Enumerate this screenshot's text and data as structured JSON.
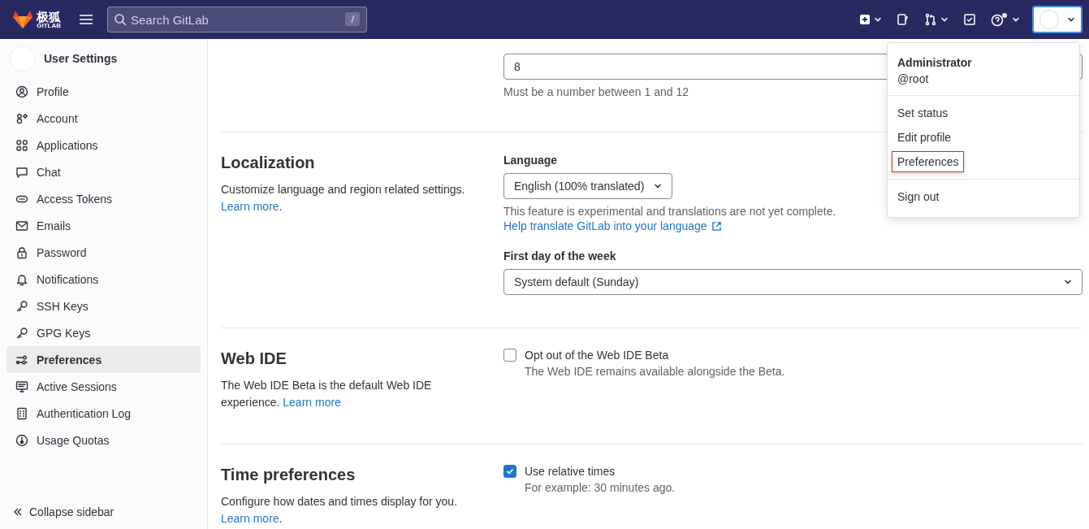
{
  "topbar": {
    "logo_text": "极狐",
    "logo_subtext": "GITLAB",
    "search": {
      "placeholder": "Search GitLab",
      "shortcut": "/"
    }
  },
  "sidebar": {
    "title": "User Settings",
    "items": [
      {
        "label": "Profile",
        "selected": false
      },
      {
        "label": "Account",
        "selected": false
      },
      {
        "label": "Applications",
        "selected": false
      },
      {
        "label": "Chat",
        "selected": false
      },
      {
        "label": "Access Tokens",
        "selected": false
      },
      {
        "label": "Emails",
        "selected": false
      },
      {
        "label": "Password",
        "selected": false
      },
      {
        "label": "Notifications",
        "selected": false
      },
      {
        "label": "SSH Keys",
        "selected": false
      },
      {
        "label": "GPG Keys",
        "selected": false
      },
      {
        "label": "Preferences",
        "selected": true
      },
      {
        "label": "Active Sessions",
        "selected": false
      },
      {
        "label": "Authentication Log",
        "selected": false
      },
      {
        "label": "Usage Quotas",
        "selected": false
      }
    ],
    "collapse": "Collapse sidebar"
  },
  "sections": [
    {
      "controls": [
        {
          "kind": "input",
          "value": "8"
        },
        {
          "kind": "help",
          "text": "Must be a number between 1 and 12"
        }
      ]
    },
    {
      "title": "Localization",
      "description": "Customize language and region related settings.",
      "link": "Learn more",
      "after": ".",
      "controls": [
        {
          "kind": "label",
          "text": "Language"
        },
        {
          "kind": "select",
          "value": "English (100% translated)",
          "compact": true
        },
        {
          "kind": "help",
          "text": "This feature is experimental and translations are not yet complete."
        },
        {
          "kind": "link",
          "text": "Help translate GitLab into your language",
          "external": true
        },
        {
          "kind": "label",
          "text": "First day of the week"
        },
        {
          "kind": "select",
          "value": "System default (Sunday)",
          "compact": false
        }
      ]
    },
    {
      "title": "Web IDE",
      "description": "The Web IDE Beta is the default Web IDE experience.",
      "link": "Learn more",
      "controls": [
        {
          "kind": "checkbox",
          "label": "Opt out of the Web IDE Beta",
          "checked": false,
          "help": "The Web IDE remains available alongside the Beta."
        }
      ]
    },
    {
      "title": "Time preferences",
      "description": "Configure how dates and times display for you.",
      "link": "Learn more",
      "after": ".",
      "controls": [
        {
          "kind": "checkbox",
          "label": "Use relative times",
          "checked": true,
          "help": "For example: 30 minutes ago."
        }
      ]
    }
  ],
  "user_menu": {
    "name": "Administrator",
    "username": "@root",
    "groups": [
      [
        {
          "label": "Set status",
          "outlined": false
        },
        {
          "label": "Edit profile",
          "outlined": false
        },
        {
          "label": "Preferences",
          "outlined": true
        }
      ],
      [
        {
          "label": "Sign out",
          "outlined": false
        }
      ]
    ]
  }
}
